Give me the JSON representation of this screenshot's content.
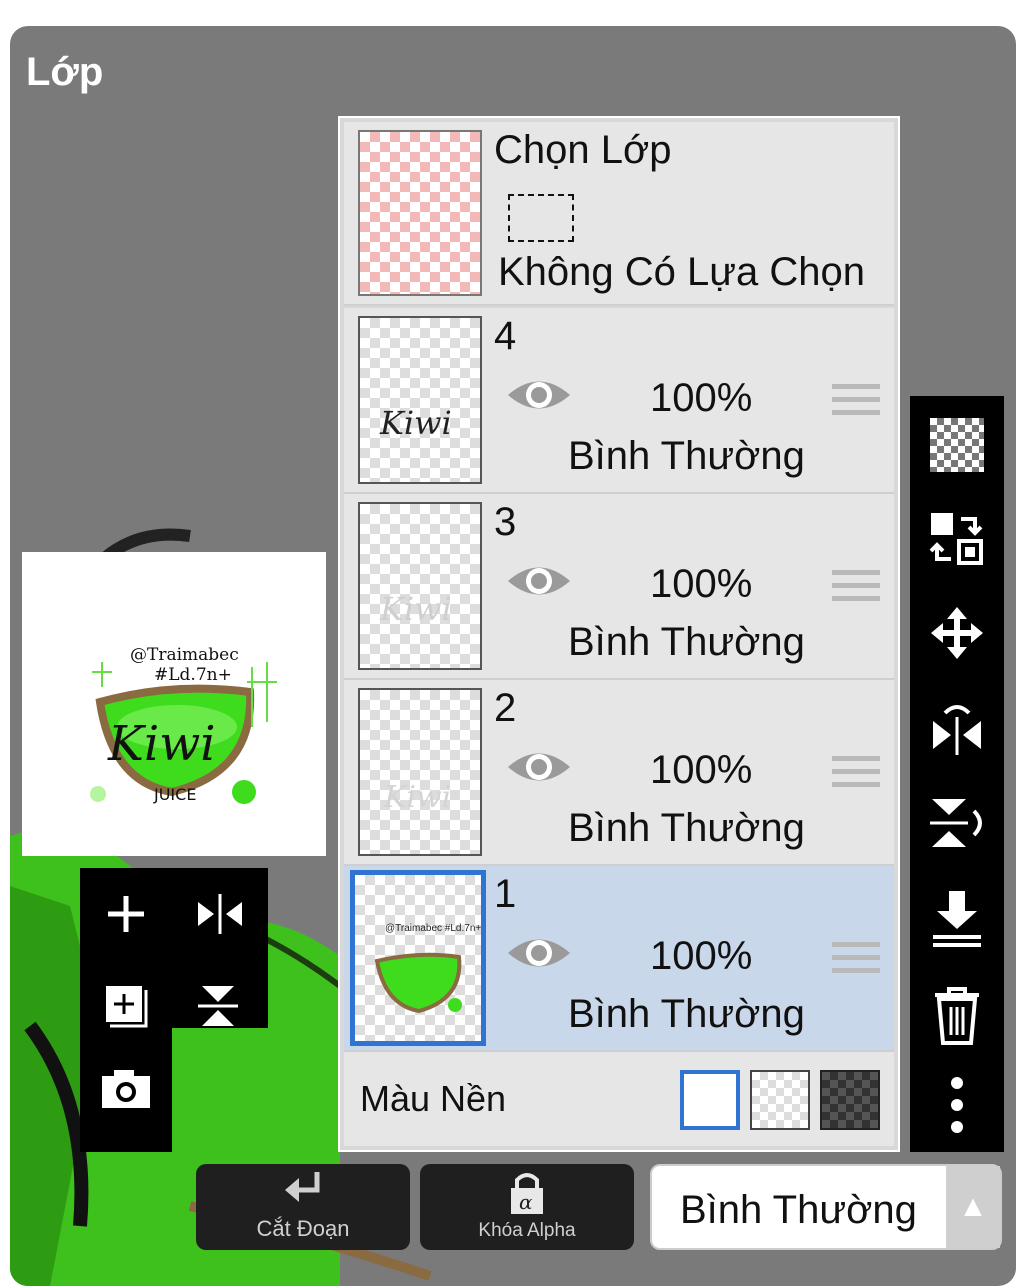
{
  "panel": {
    "title": "Lớp"
  },
  "selection_row": {
    "title": "Chọn Lớp",
    "status": "Không Có Lựa Chọn"
  },
  "layers": [
    {
      "name": "4",
      "opacity": "100%",
      "blend": "Bình Thường",
      "visible": true,
      "selected": false,
      "thumb_text": "Kiwi"
    },
    {
      "name": "3",
      "opacity": "100%",
      "blend": "Bình Thường",
      "visible": true,
      "selected": false,
      "thumb_text": "Kiwi"
    },
    {
      "name": "2",
      "opacity": "100%",
      "blend": "Bình Thường",
      "visible": true,
      "selected": false,
      "thumb_text": "Kiwi"
    },
    {
      "name": "1",
      "opacity": "100%",
      "blend": "Bình Thường",
      "visible": true,
      "selected": true,
      "thumb_text": "@Traimabec #Ld.7n+"
    }
  ],
  "background_row": {
    "label": "Màu Nền",
    "options": [
      "white",
      "transparent",
      "dark-checker"
    ],
    "selected": "white"
  },
  "preview": {
    "line1": "@Traimabec",
    "line2": "#Ld.7n+",
    "word": "Kiwi",
    "sub": "JUICE"
  },
  "right_tools": [
    "transparent-checker-icon",
    "swap-layer-icon",
    "move-icon",
    "flip-horizontal-icon",
    "flip-vertical-icon",
    "merge-down-icon",
    "trash-icon",
    "more-vert-icon"
  ],
  "left_tools": [
    "add-layer-icon",
    "flip-horizontal-icon",
    "add-copy-layer-icon",
    "flip-vertical-icon",
    "camera-icon"
  ],
  "bottom": {
    "clip_label": "Cắt Đoạn",
    "alpha_lock_label": "Khóa Alpha",
    "blend_mode": "Bình Thường"
  },
  "colors": {
    "accent": "#2f74d0",
    "selected_row": "#c9d7ea",
    "panel_bg": "#7a7a7a",
    "toolbar": "#000000",
    "kiwi_green": "#3fdc1e"
  }
}
